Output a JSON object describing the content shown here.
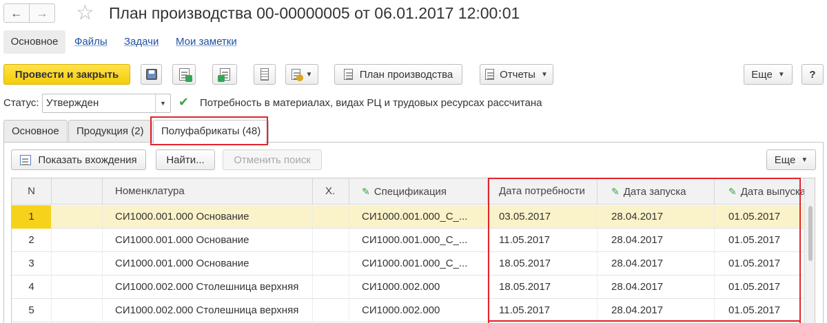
{
  "header": {
    "back": "←",
    "forward": "→",
    "title": "План производства 00-00000005 от 06.01.2017 12:00:01"
  },
  "section_tabs": [
    {
      "label": "Основное"
    },
    {
      "label": "Файлы"
    },
    {
      "label": "Задачи"
    },
    {
      "label": "Мои заметки"
    }
  ],
  "toolbar": {
    "post_close": "Провести и закрыть",
    "plan_label": "План производства",
    "reports_label": "Отчеты",
    "more_label": "Еще",
    "help_label": "?"
  },
  "status": {
    "label": "Статус:",
    "value": "Утвержден",
    "message": "Потребность в материалах, видах РЦ и трудовых ресурсах рассчитана"
  },
  "inner_tabs": [
    {
      "label": "Основное"
    },
    {
      "label": "Продукция (2)"
    },
    {
      "label": "Полуфабрикаты (48)"
    }
  ],
  "grid_toolbar": {
    "show_entries": "Показать вхождения",
    "find": "Найти...",
    "cancel_search": "Отменить поиск",
    "more": "Еще"
  },
  "table": {
    "columns": [
      "N",
      "",
      "Номенклатура",
      "Х.",
      "Спецификация",
      "Дата потребности",
      "Дата запуска",
      "Дата выпуска"
    ],
    "rows": [
      {
        "n": "1",
        "nom": "СИ1000.001.000 Основание",
        "spec": "СИ1000.001.000_С_...",
        "need": "03.05.2017",
        "start": "28.04.2017",
        "release": "01.05.2017"
      },
      {
        "n": "2",
        "nom": "СИ1000.001.000 Основание",
        "spec": "СИ1000.001.000_С_...",
        "need": "11.05.2017",
        "start": "28.04.2017",
        "release": "01.05.2017"
      },
      {
        "n": "3",
        "nom": "СИ1000.001.000 Основание",
        "spec": "СИ1000.001.000_С_...",
        "need": "18.05.2017",
        "start": "28.04.2017",
        "release": "01.05.2017"
      },
      {
        "n": "4",
        "nom": "СИ1000.002.000 Столешница верхняя",
        "spec": "СИ1000.002.000",
        "need": "18.05.2017",
        "start": "28.04.2017",
        "release": "01.05.2017"
      },
      {
        "n": "5",
        "nom": "СИ1000.002.000 Столешница верхняя",
        "spec": "СИ1000.002.000",
        "need": "11.05.2017",
        "start": "28.04.2017",
        "release": "01.05.2017"
      }
    ]
  },
  "colors": {
    "primary_button": "#f5cd0a",
    "selected_row": "#faf2c8",
    "highlight_frame": "#e0252b",
    "link": "#1e4fa3"
  }
}
